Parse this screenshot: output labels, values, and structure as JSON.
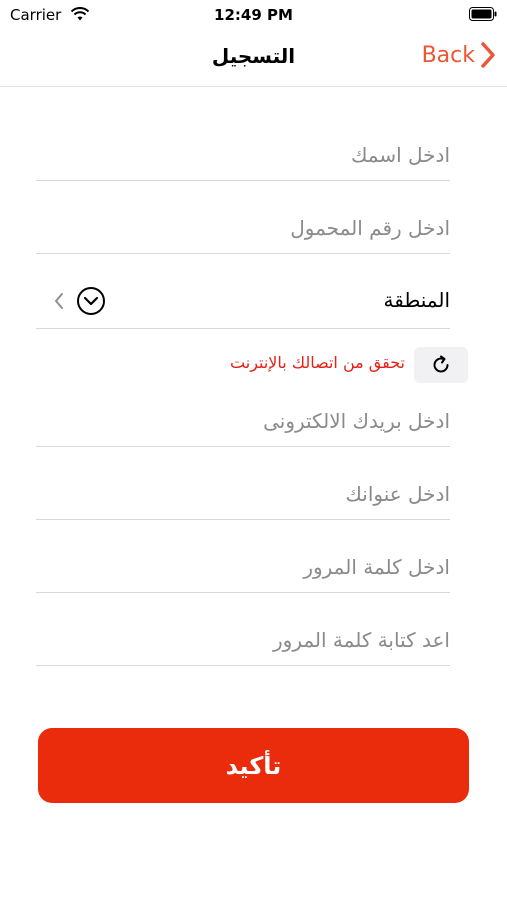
{
  "status_bar": {
    "carrier": "Carrier",
    "time": "12:49 PM"
  },
  "nav": {
    "title": "التسجيل",
    "back_label": "Back"
  },
  "form": {
    "name_placeholder": "ادخل اسمك",
    "phone_placeholder": "ادخل رقم المحمول",
    "region_label": "المنطقة",
    "error_message": "تحقق من اتصالك بالإنترنت",
    "email_placeholder": "ادخل بريدك الالكترونى",
    "address_placeholder": "ادخل عنوانك",
    "password_placeholder": "ادخل كلمة المرور",
    "confirm_password_placeholder": "اعد كتابة كلمة المرور"
  },
  "confirm_label": "تأكيد",
  "colors": {
    "accent": "#ea2c0c",
    "back": "#ea5637",
    "error": "#e62117"
  },
  "icons": [
    "wifi-icon",
    "battery-icon",
    "chevron-right-icon",
    "chevron-down-circle-icon",
    "chevron-left-icon",
    "refresh-icon"
  ]
}
